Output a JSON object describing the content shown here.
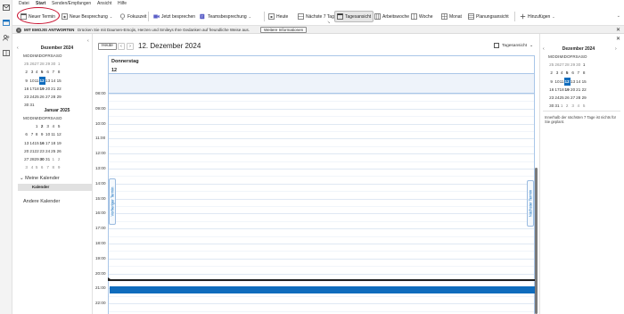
{
  "menu": {
    "items": [
      "Datei",
      "Start",
      "Senden/Empfangen",
      "Ansicht",
      "Hilfe"
    ]
  },
  "ribbon": {
    "new_appointment": "Neuer Termin",
    "new_meeting": "Neue Besprechung",
    "focus": "Fokuszeit",
    "meet_now": "Jetzt besprechen",
    "teams_meeting": "Teamsbesprechung",
    "today": "Heute",
    "next7": "Nächste 7 Tage",
    "day_view": "Tagesansicht",
    "work_week": "Arbeitswoche",
    "week": "Woche",
    "month": "Monat",
    "schedule": "Planungsansicht",
    "addins": "Hinzufügen"
  },
  "infobar": {
    "title": "MIT EMOJIS ANTWORTEN",
    "message": "Drücken Sie mit Daumen-Emojis, Herzen und Smileys Ihre Gedanken auf freundliche Weise aus.",
    "more": "Weitere Informationen",
    "close": "✕"
  },
  "left": {
    "dec": {
      "title": "Dezember 2024",
      "dow": [
        "MO",
        "DI",
        "MI",
        "DO",
        "FR",
        "SA",
        "SO"
      ],
      "weeks": [
        [
          "25",
          "26",
          "27",
          "28",
          "29",
          "30",
          "1"
        ],
        [
          "2",
          "3",
          "4",
          "5",
          "6",
          "7",
          "8"
        ],
        [
          "9",
          "10",
          "11",
          "12",
          "13",
          "14",
          "15"
        ],
        [
          "16",
          "17",
          "18",
          "19",
          "20",
          "21",
          "22"
        ],
        [
          "23",
          "24",
          "25",
          "26",
          "27",
          "28",
          "29"
        ],
        [
          "30",
          "31",
          "",
          "",
          "",
          "",
          ""
        ]
      ]
    },
    "jan": {
      "title": "Januar 2025",
      "dow": [
        "MO",
        "DI",
        "MI",
        "DO",
        "FR",
        "SA",
        "SO"
      ],
      "weeks": [
        [
          "",
          "",
          "1",
          "2",
          "3",
          "4",
          "5"
        ],
        [
          "6",
          "7",
          "8",
          "9",
          "10",
          "11",
          "12"
        ],
        [
          "13",
          "14",
          "15",
          "16",
          "17",
          "18",
          "19"
        ],
        [
          "20",
          "21",
          "22",
          "23",
          "24",
          "25",
          "26"
        ],
        [
          "27",
          "28",
          "29",
          "30",
          "31",
          "1",
          "2"
        ],
        [
          "3",
          "4",
          "5",
          "6",
          "7",
          "8",
          "9"
        ]
      ]
    },
    "my_calendars": "Meine Kalender",
    "calendar_item": "Kalender",
    "other_calendars": "Andere Kalender"
  },
  "main": {
    "today_btn": "Heute",
    "prev": "‹",
    "next": "›",
    "date_title": "12. Dezember 2024",
    "view_label": "Tagesansicht",
    "day_name": "Donnerstag",
    "day_num": "12",
    "prev_appt": "Vorheriger Termin",
    "next_appt": "Nächster Termin",
    "times": [
      "08:00",
      "09:00",
      "10:00",
      "11:00",
      "12:00",
      "13:00",
      "14:00",
      "15:00",
      "16:00",
      "17:00",
      "18:00",
      "19:00",
      "20:00",
      "21:00",
      "22:00"
    ]
  },
  "right": {
    "title": "Dezember 2024",
    "dow": [
      "MO",
      "DI",
      "MI",
      "DO",
      "FR",
      "SA",
      "SO"
    ],
    "weeks": [
      [
        "25",
        "26",
        "27",
        "28",
        "29",
        "30",
        "1"
      ],
      [
        "2",
        "3",
        "4",
        "5",
        "6",
        "7",
        "8"
      ],
      [
        "9",
        "10",
        "11",
        "12",
        "13",
        "14",
        "15"
      ],
      [
        "16",
        "17",
        "18",
        "19",
        "20",
        "21",
        "22"
      ],
      [
        "23",
        "24",
        "25",
        "26",
        "27",
        "28",
        "29"
      ],
      [
        "30",
        "31",
        "1",
        "2",
        "3",
        "4",
        "5"
      ]
    ],
    "note": "Innerhalb der nächsten 7 Tage ist nichts für Sie geplant.",
    "close": "✕"
  },
  "colors": {
    "accent": "#0f6cbd",
    "highlight_ring": "#c8102e"
  }
}
